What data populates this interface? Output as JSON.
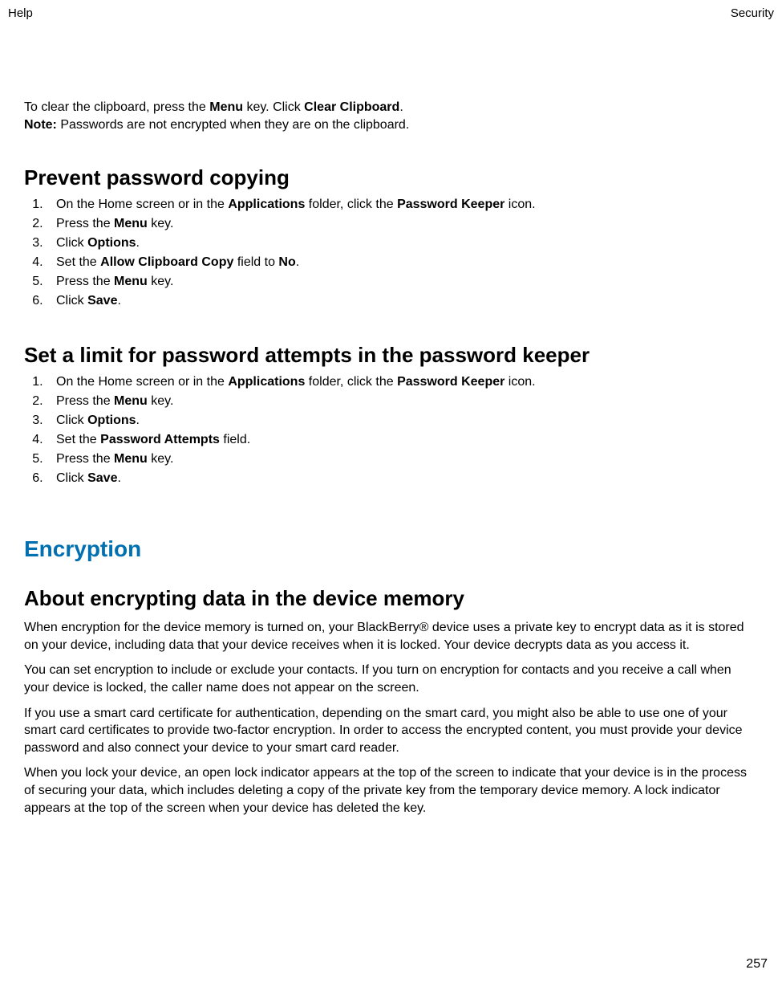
{
  "header": {
    "left": "Help",
    "right": "Security"
  },
  "intro": {
    "line1_pre": "To clear the clipboard, press the ",
    "line1_b1": "Menu",
    "line1_mid": " key. Click ",
    "line1_b2": "Clear Clipboard",
    "line1_post": ".",
    "note_label": "Note:",
    "note_text": "  Passwords are not encrypted when they are on the clipboard."
  },
  "sec1": {
    "title": "Prevent password copying",
    "s1_pre": "On the Home screen or in the ",
    "s1_b1": "Applications",
    "s1_mid": " folder, click the ",
    "s1_b2": "Password Keeper",
    "s1_post": " icon.",
    "s2_pre": "Press the ",
    "s2_b": "Menu",
    "s2_post": " key.",
    "s3_pre": "Click ",
    "s3_b": "Options",
    "s3_post": ".",
    "s4_pre": "Set the ",
    "s4_b1": "Allow Clipboard Copy",
    "s4_mid": " field to ",
    "s4_b2": "No",
    "s4_post": ".",
    "s5_pre": "Press the ",
    "s5_b": "Menu",
    "s5_post": " key.",
    "s6_pre": "Click ",
    "s6_b": "Save",
    "s6_post": "."
  },
  "sec2": {
    "title": "Set a limit for password attempts in the password keeper",
    "s1_pre": "On the Home screen or in the ",
    "s1_b1": "Applications",
    "s1_mid": " folder, click the ",
    "s1_b2": "Password Keeper",
    "s1_post": " icon.",
    "s2_pre": "Press the ",
    "s2_b": "Menu",
    "s2_post": " key.",
    "s3_pre": "Click ",
    "s3_b": "Options",
    "s3_post": ".",
    "s4_pre": "Set the ",
    "s4_b": "Password Attempts",
    "s4_post": " field.",
    "s5_pre": "Press the ",
    "s5_b": "Menu",
    "s5_post": " key.",
    "s6_pre": "Click ",
    "s6_b": "Save",
    "s6_post": "."
  },
  "encryption": {
    "title": "Encryption",
    "sub": "About encrypting data in the device memory",
    "p1": "When encryption for the device memory is turned on, your BlackBerry® device uses a private key to encrypt data as it is stored on your device, including data that your device receives when it is locked. Your device decrypts data as you access it.",
    "p2": "You can set encryption to include or exclude your contacts. If you turn on encryption for contacts and you receive a call when your device is locked, the caller name does not appear on the screen.",
    "p3": "If you use a smart card certificate for authentication, depending on the smart card, you might also be able to use one of your smart card certificates to provide two-factor encryption. In order to access the encrypted content, you must provide your device password and also connect your device to your smart card reader.",
    "p4": "When you lock your device, an open lock indicator appears at the top of the screen to indicate that your device is in the process of securing your data, which includes deleting a copy of the private key from the temporary device memory. A lock indicator appears at the top of the screen when your device has deleted the key."
  },
  "page_number": "257"
}
